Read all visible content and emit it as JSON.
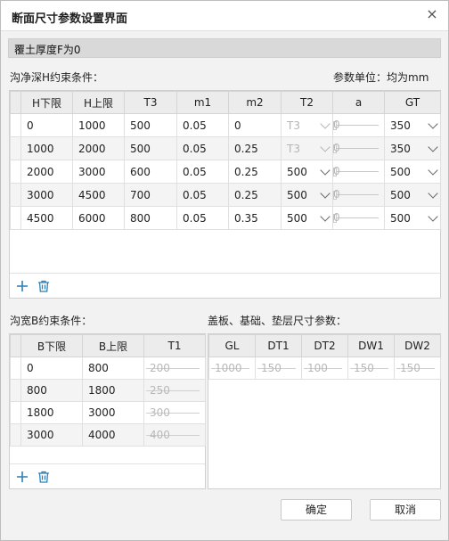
{
  "dialog": {
    "title": "断面尺寸参数设置界面",
    "close_glyph": "×"
  },
  "banner": {
    "text": "覆土厚度F为0"
  },
  "h_section": {
    "label": "沟净深H约束条件：",
    "unit_label": "参数单位：均为mm",
    "columns": [
      "H下限",
      "H上限",
      "T3",
      "m1",
      "m2",
      "T2",
      "a",
      "GT"
    ],
    "rows": [
      {
        "h_min": "0",
        "h_max": "1000",
        "t3": "500",
        "m1": "0.05",
        "m2": "0",
        "t2": "T3",
        "t2_disabled": true,
        "a": "0",
        "gt": "350"
      },
      {
        "h_min": "1000",
        "h_max": "2000",
        "t3": "500",
        "m1": "0.05",
        "m2": "0.25",
        "t2": "T3",
        "t2_disabled": true,
        "a": "0",
        "gt": "350"
      },
      {
        "h_min": "2000",
        "h_max": "3000",
        "t3": "600",
        "m1": "0.05",
        "m2": "0.25",
        "t2": "500",
        "t2_disabled": false,
        "a": "0",
        "gt": "500"
      },
      {
        "h_min": "3000",
        "h_max": "4500",
        "t3": "700",
        "m1": "0.05",
        "m2": "0.25",
        "t2": "500",
        "t2_disabled": false,
        "a": "0",
        "gt": "500"
      },
      {
        "h_min": "4500",
        "h_max": "6000",
        "t3": "800",
        "m1": "0.05",
        "m2": "0.35",
        "t2": "500",
        "t2_disabled": false,
        "a": "0",
        "gt": "500"
      }
    ]
  },
  "b_section": {
    "label": "沟宽B约束条件：",
    "columns": [
      "B下限",
      "B上限",
      "T1"
    ],
    "rows": [
      {
        "b_min": "0",
        "b_max": "800",
        "t1": "200"
      },
      {
        "b_min": "800",
        "b_max": "1800",
        "t1": "250"
      },
      {
        "b_min": "1800",
        "b_max": "3000",
        "t1": "300"
      },
      {
        "b_min": "3000",
        "b_max": "4000",
        "t1": "400"
      }
    ]
  },
  "base_section": {
    "label": "盖板、基础、垫层尺寸参数：",
    "columns": [
      "GL",
      "DT1",
      "DT2",
      "DW1",
      "DW2"
    ],
    "row": {
      "gl": "1000",
      "dt1": "150",
      "dt2": "100",
      "dw1": "150",
      "dw2": "150"
    }
  },
  "icons": {
    "add": "plus-icon",
    "delete": "trash-icon"
  },
  "buttons": {
    "ok": "确定",
    "cancel": "取消"
  },
  "colors": {
    "icon_blue": "#2c7fb8",
    "disabled_text": "#b8b8b8"
  }
}
